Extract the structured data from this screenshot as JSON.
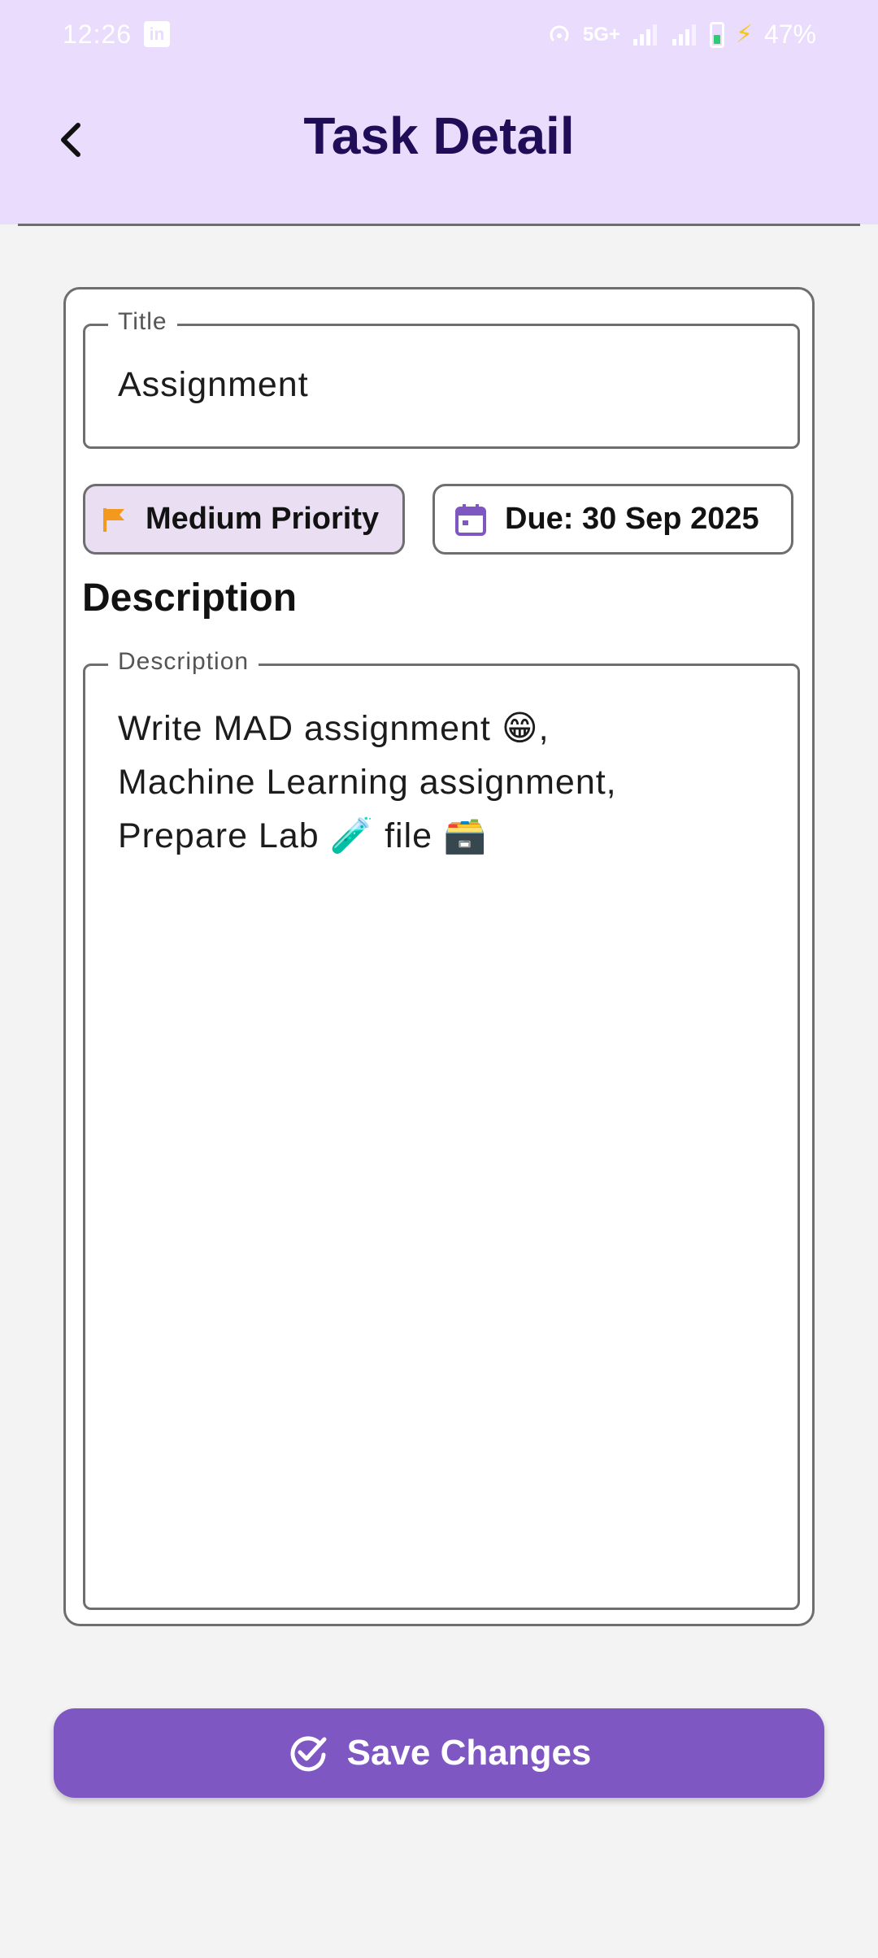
{
  "status_bar": {
    "time": "12:26",
    "linkedin_icon": "linkedin-icon",
    "network": "5G+",
    "battery_percent": "47%"
  },
  "header": {
    "title": "Task Detail",
    "back_icon": "chevron-left-icon"
  },
  "form": {
    "title_label": "Title",
    "title_value": "Assignment",
    "priority_label": "Medium Priority",
    "priority_icon": "flag-icon",
    "priority_color": "#f39a1e",
    "due_label": "Due: 30 Sep 2025",
    "due_icon": "calendar-icon",
    "due_icon_color": "#7e57c2",
    "description_heading": "Description",
    "description_label": "Description",
    "description_lines": [
      "Write MAD assignment 😁,",
      "Machine Learning assignment,",
      "Prepare Lab 🧪 file 🗃️"
    ]
  },
  "actions": {
    "save_label": "Save Changes",
    "save_icon": "check-circle-icon",
    "save_color": "#7e57c2"
  }
}
